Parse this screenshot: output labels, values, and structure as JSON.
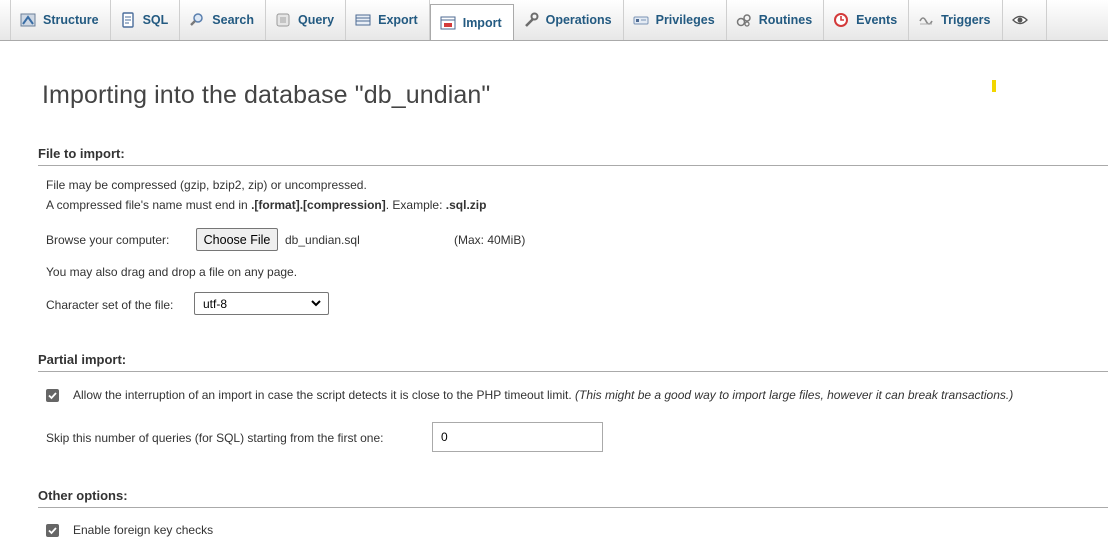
{
  "tabs": [
    {
      "label": "Structure",
      "icon": "structure-icon"
    },
    {
      "label": "SQL",
      "icon": "sql-icon"
    },
    {
      "label": "Search",
      "icon": "search-icon"
    },
    {
      "label": "Query",
      "icon": "query-icon"
    },
    {
      "label": "Export",
      "icon": "export-icon"
    },
    {
      "label": "Import",
      "icon": "import-icon",
      "active": true
    },
    {
      "label": "Operations",
      "icon": "wrench-icon"
    },
    {
      "label": "Privileges",
      "icon": "privileges-icon"
    },
    {
      "label": "Routines",
      "icon": "routines-icon"
    },
    {
      "label": "Events",
      "icon": "clock-icon"
    },
    {
      "label": "Triggers",
      "icon": "triggers-icon"
    },
    {
      "label": "",
      "icon": "eye-icon"
    }
  ],
  "title": "Importing into the database \"db_undian\"",
  "file_section": {
    "heading": "File to import:",
    "line1": "File may be compressed (gzip, bzip2, zip) or uncompressed.",
    "line2_prefix": "A compressed file's name must end in ",
    "line2_bold": ".[format].[compression]",
    "line2_mid": ". Example: ",
    "line2_example": ".sql.zip",
    "browse_label": "Browse your computer:",
    "choose_button": "Choose File",
    "file_name": "db_undian.sql",
    "max_size": "(Max: 40MiB)",
    "drag_note": "You may also drag and drop a file on any page.",
    "charset_label": "Character set of the file:",
    "charset_value": "utf-8"
  },
  "partial_section": {
    "heading": "Partial import:",
    "allow_label": "Allow the interruption of an import in case the script detects it is close to the PHP timeout limit.",
    "allow_note": "(This might be a good way to import large files, however it can break transactions.)",
    "allow_checked": true,
    "skip_label": "Skip this number of queries (for SQL) starting from the first one:",
    "skip_value": "0"
  },
  "other_section": {
    "heading": "Other options:",
    "fk_label": "Enable foreign key checks",
    "fk_checked": true
  },
  "colors": {
    "tab_text": "#235a81",
    "checkbox": "#666666",
    "marker": "#f2d600"
  }
}
